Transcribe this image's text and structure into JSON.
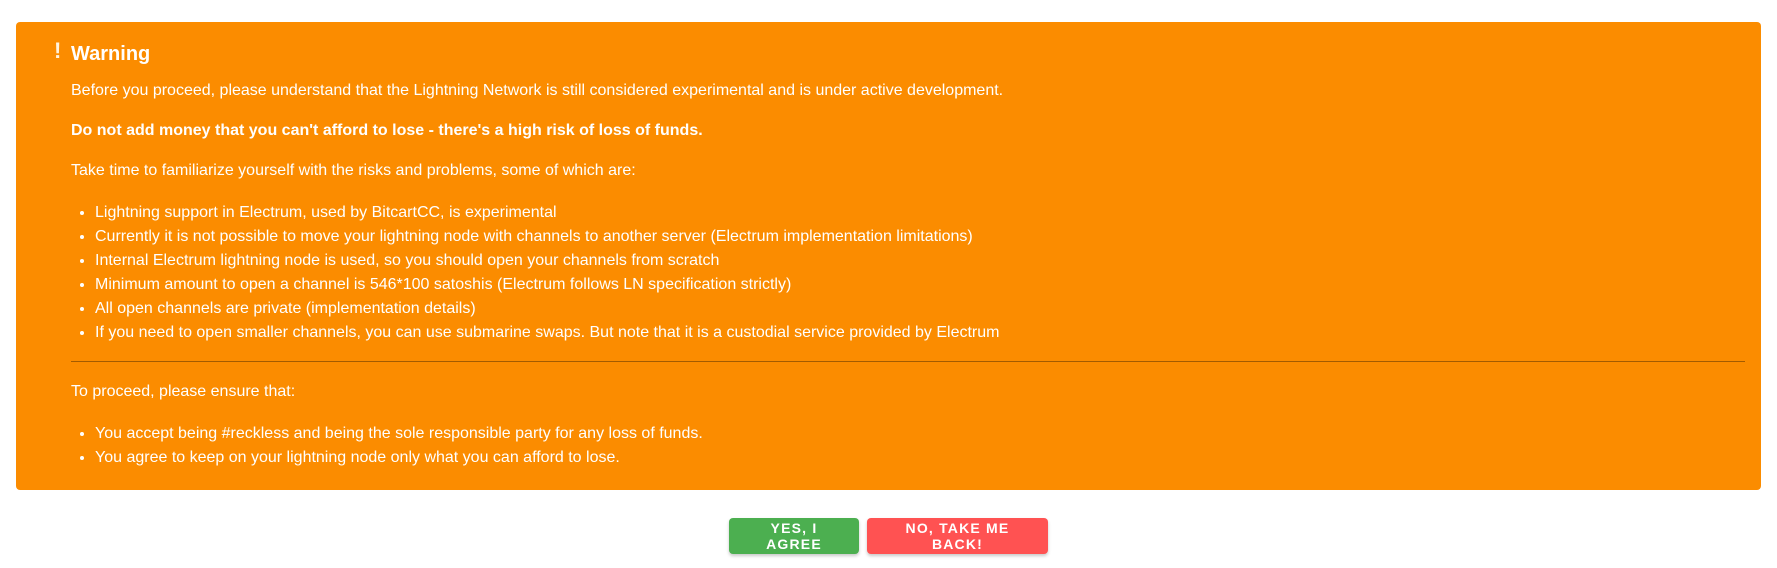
{
  "alert": {
    "icon": "exclamation-icon",
    "color": "#fb8c00",
    "title": "Warning",
    "intro": "Before you proceed, please understand that the Lightning Network is still considered experimental and is under active development.",
    "bold_warning": "Do not add money that you can't afford to lose - there's a high risk of loss of funds.",
    "risks_intro": "Take time to familiarize yourself with the risks and problems, some of which are:",
    "risks": [
      "Lightning support in Electrum, used by BitcartCC, is experimental",
      "Currently it is not possible to move your lightning node with channels to another server (Electrum implementation limitations)",
      "Internal Electrum lightning node is used, so you should open your channels from scratch",
      "Minimum amount to open a channel is 546*100 satoshis (Electrum follows LN specification strictly)",
      "All open channels are private (implementation details)",
      "If you need to open smaller channels, you can use submarine swaps. But note that it is a custodial service provided by Electrum"
    ],
    "proceed_intro": "To proceed, please ensure that:",
    "conditions": [
      "You accept being #reckless and being the sole responsible party for any loss of funds.",
      "You agree to keep on your lightning node only what you can afford to lose."
    ]
  },
  "actions": {
    "agree_label": "Yes, I agree",
    "agree_color": "#4caf50",
    "back_label": "No, take me back!",
    "back_color": "#ff5252"
  }
}
